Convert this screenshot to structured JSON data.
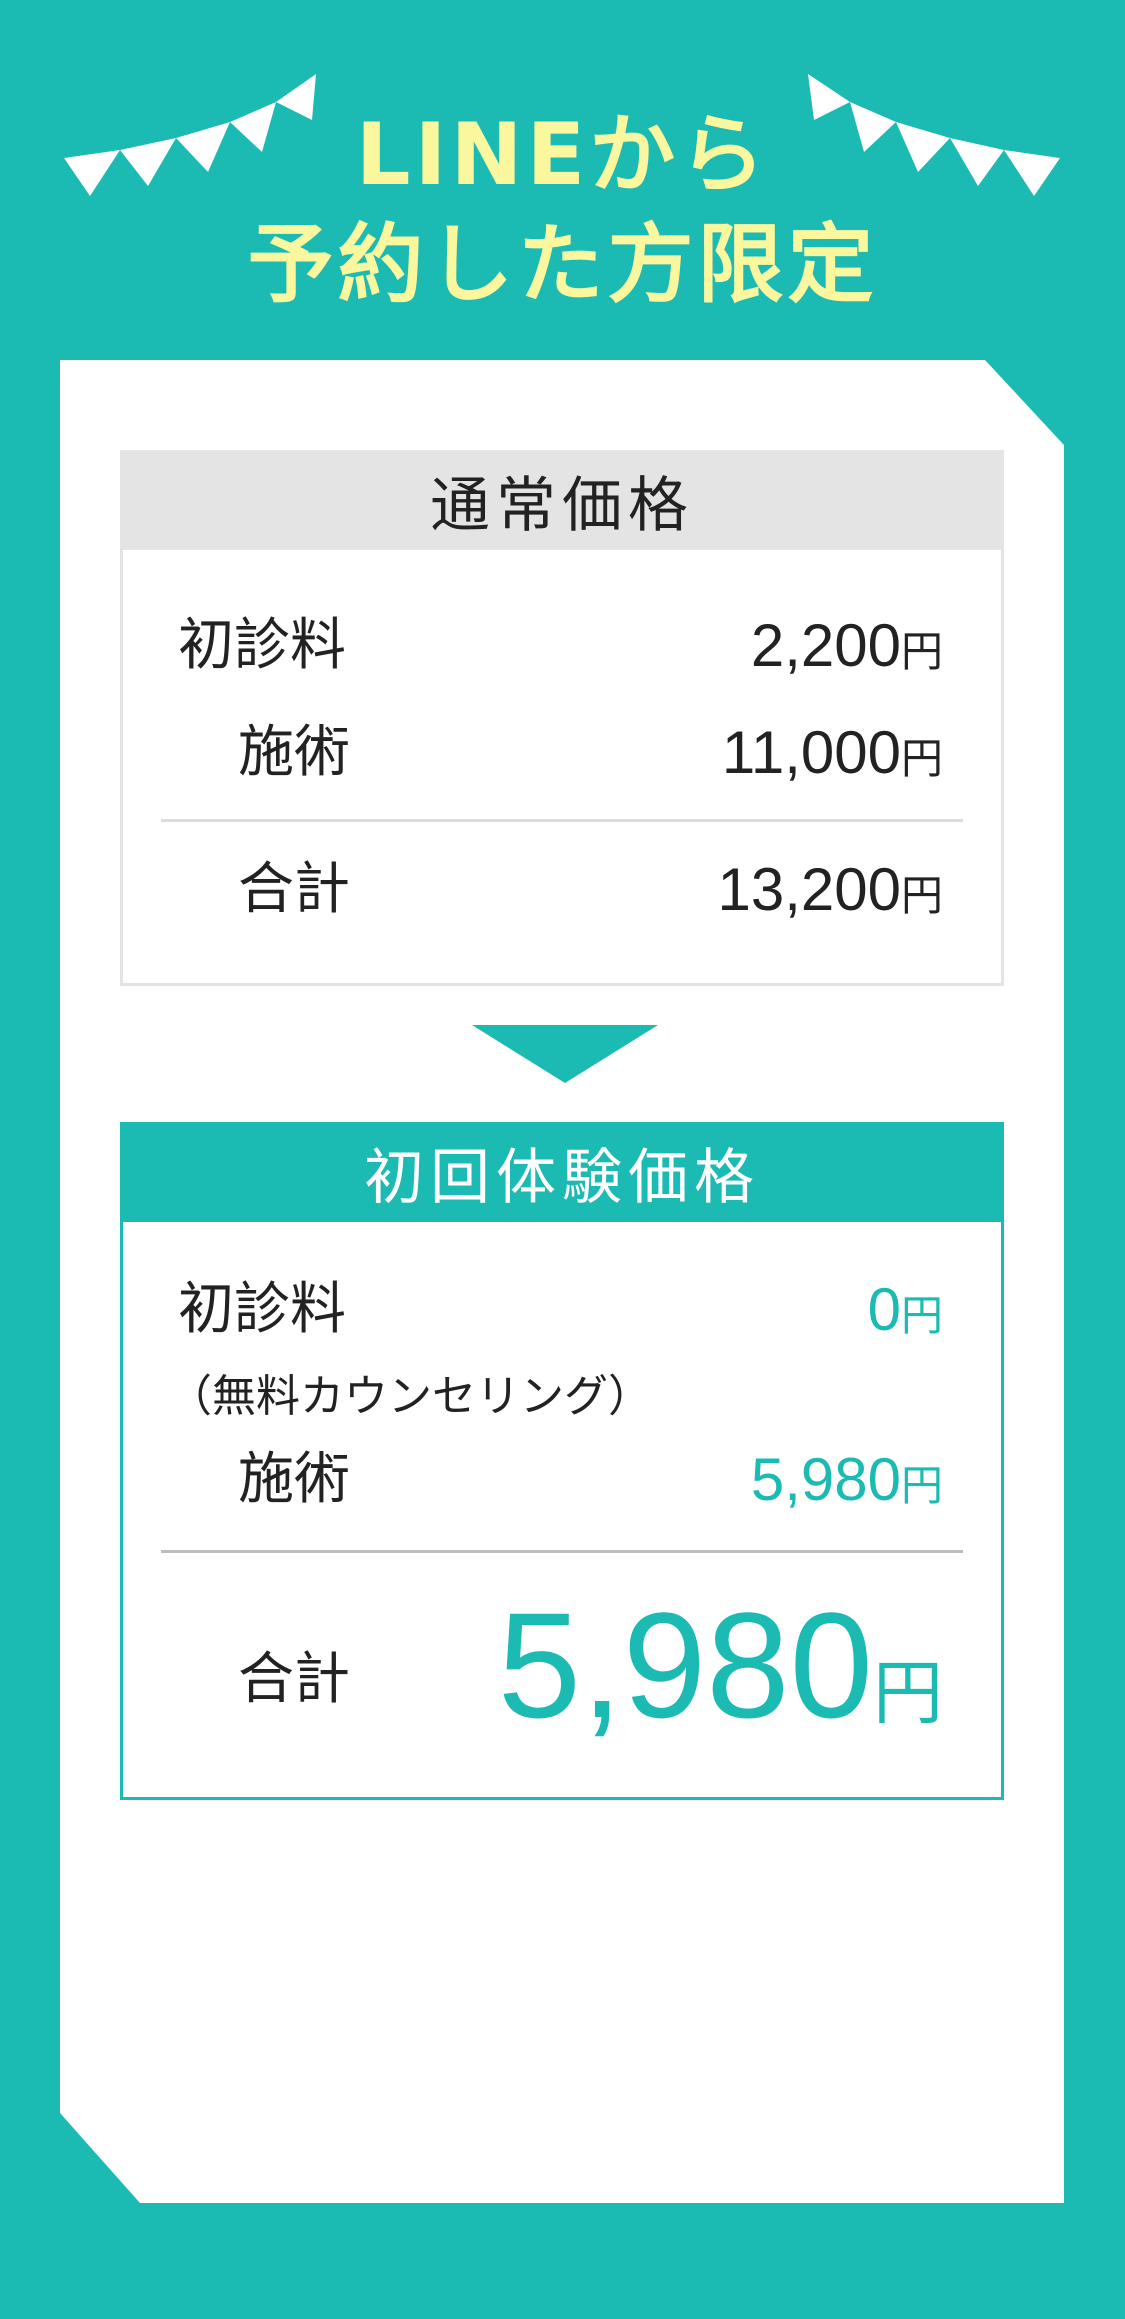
{
  "headline": {
    "line1": "LINEから",
    "line2": "予約した方限定"
  },
  "regular": {
    "title": "通常価格",
    "rows": [
      {
        "label": "初診料",
        "amount": "2,200",
        "unit": "円"
      },
      {
        "label": "施術",
        "amount": "11,000",
        "unit": "円"
      }
    ],
    "total": {
      "label": "合計",
      "amount": "13,200",
      "unit": "円"
    }
  },
  "trial": {
    "title": "初回体験価格",
    "rows": [
      {
        "label": "初診料",
        "note": "（無料カウンセリング）",
        "amount": "0",
        "unit": "円"
      },
      {
        "label": "施術",
        "amount": "5,980",
        "unit": "円"
      }
    ],
    "total": {
      "label": "合計",
      "amount": "5,980",
      "unit": "円"
    }
  },
  "colors": {
    "brand_teal": "#1bbbb3",
    "headline_yellow": "#fbf79e",
    "card_white": "#ffffff",
    "header_gray": "#e4e4e4"
  },
  "icons": {
    "bunting_left": "pennant-garland-icon",
    "bunting_right": "pennant-garland-icon",
    "arrow": "down-arrow-icon"
  }
}
